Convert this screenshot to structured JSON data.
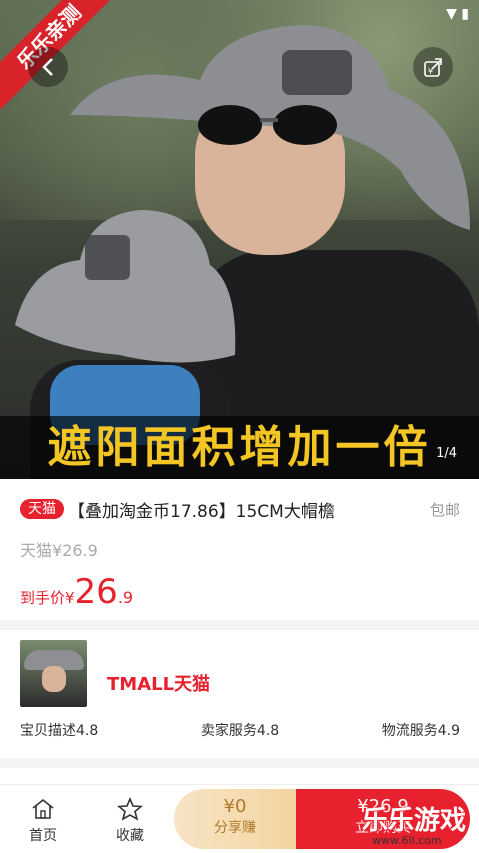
{
  "hero": {
    "banner_text": "遮阳面积增加一倍",
    "page_indicator": "1/4",
    "corner_ribbon": "乐乐亲测"
  },
  "product": {
    "tag": "天猫",
    "title": "【叠加淘金币17.86】15CM大帽檐",
    "shipping": "包邮",
    "original_price": "天猫¥26.9",
    "final_price_label": "到手价¥",
    "final_price_int": "26",
    "final_price_dec": ".9"
  },
  "shop": {
    "logo_text": "TMALL天猫",
    "ratings": [
      {
        "label": "宝贝描述4.8"
      },
      {
        "label": "卖家服务4.8"
      },
      {
        "label": "物流服务4.9"
      }
    ]
  },
  "bottom_bar": {
    "home_label": "首页",
    "favorite_label": "收藏",
    "share_amount": "¥0",
    "share_label": "分享赚",
    "buy_amount": "¥26.9",
    "buy_label": "立即购买"
  },
  "watermark": {
    "brand": "乐乐游戏",
    "url": "www.6ll.com"
  },
  "colors": {
    "accent": "#e8212e",
    "banner_text": "#f3c624",
    "share_bg": "#f3d4a0"
  }
}
